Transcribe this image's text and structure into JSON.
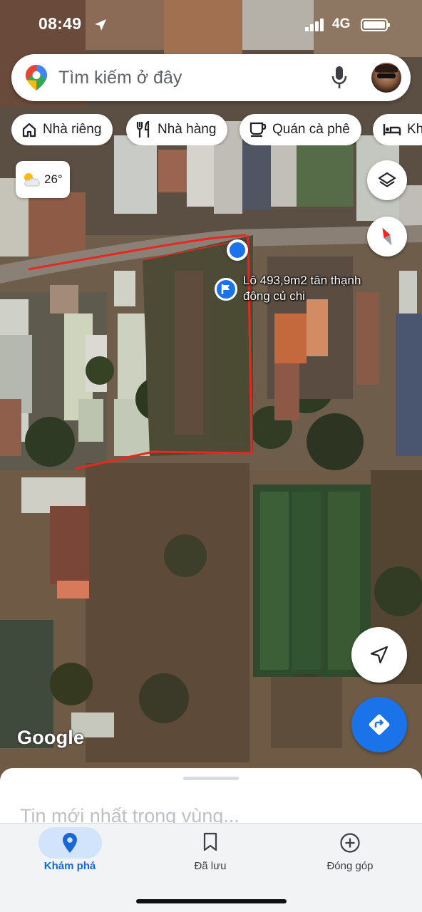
{
  "status_bar": {
    "time": "08:49",
    "network": "4G"
  },
  "search": {
    "placeholder": "Tìm kiếm ở đây",
    "icons": [
      "google-maps-pin-icon",
      "mic-icon"
    ]
  },
  "chips": [
    {
      "label": "Nhà riêng",
      "icon": "home-icon"
    },
    {
      "label": "Nhà hàng",
      "icon": "restaurant-icon"
    },
    {
      "label": "Quán cà phê",
      "icon": "coffee-icon"
    },
    {
      "label": "Kh",
      "icon": "hotel-icon"
    }
  ],
  "weather": {
    "temperature": "26°",
    "icon": "partly-cloudy-icon"
  },
  "map": {
    "pin_label": "Lô 493,9m2 tân thạnh đông củ chi",
    "attribution": "Google",
    "boundary_color": "#e8271f",
    "accent_color": "#1a73e8"
  },
  "sheet": {
    "title": "Tin mới nhất trong vùng..."
  },
  "bottom_nav": {
    "items": [
      {
        "label": "Khám phá",
        "icon": "explore-pin-icon",
        "active": true
      },
      {
        "label": "Đã lưu",
        "icon": "bookmark-icon",
        "active": false
      },
      {
        "label": "Đóng góp",
        "icon": "add-circle-icon",
        "active": false
      }
    ]
  }
}
